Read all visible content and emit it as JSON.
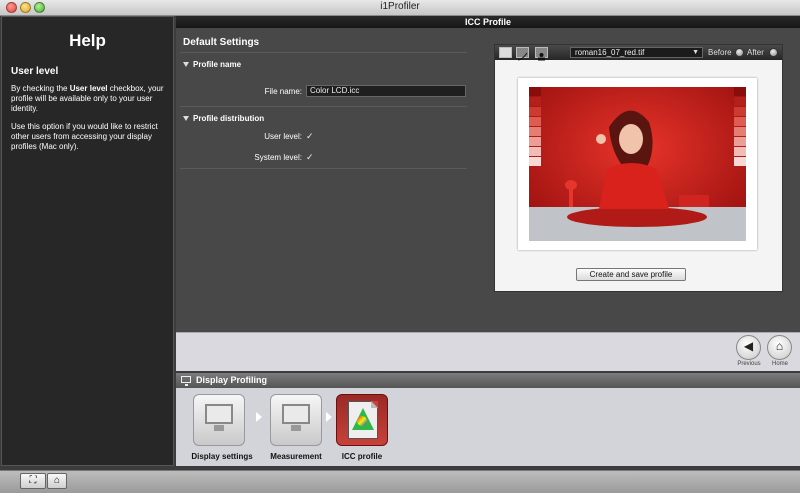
{
  "window": {
    "title": "i1Profiler"
  },
  "help": {
    "title": "Help",
    "subtitle": "User level",
    "para1_before": "By checking the ",
    "para1_bold": "User level",
    "para1_after": " checkbox, your profile will be available only to your user identity.",
    "para2": "Use this option if you would like to restrict other users from accessing your display profiles (Mac only)."
  },
  "panel": {
    "header": "ICC Profile"
  },
  "settings": {
    "heading": "Default Settings",
    "profile_name_section": "Profile name",
    "file_name_label": "File name:",
    "file_name_value": "Color LCD.icc",
    "distribution_section": "Profile distribution",
    "user_level_label": "User level:",
    "user_level_checked": true,
    "system_level_label": "System level:",
    "system_level_checked": true,
    "check_glyph": "✓"
  },
  "preview": {
    "image_select": "roman16_07_red.tif",
    "before_label": "Before",
    "after_label": "After",
    "create_button": "Create and save profile",
    "toolbar_icons": [
      "gamut-icon",
      "curve-icon",
      "image-icon"
    ]
  },
  "nav": {
    "previous_label": "Previous",
    "home_label": "Home",
    "previous_glyph": "◀",
    "home_glyph": "⌂"
  },
  "workflow": {
    "title": "Display Profiling",
    "steps": [
      {
        "label": "Display settings",
        "active": false
      },
      {
        "label": "Measurement",
        "active": false
      },
      {
        "label": "ICC profile",
        "active": true
      }
    ]
  },
  "bottom": {
    "fullscreen_glyph": "⛶",
    "home_glyph": "⌂"
  },
  "colors": {
    "accent_red": "#c8413a",
    "dark_panel": "#272727",
    "pane_bg": "#484848"
  }
}
